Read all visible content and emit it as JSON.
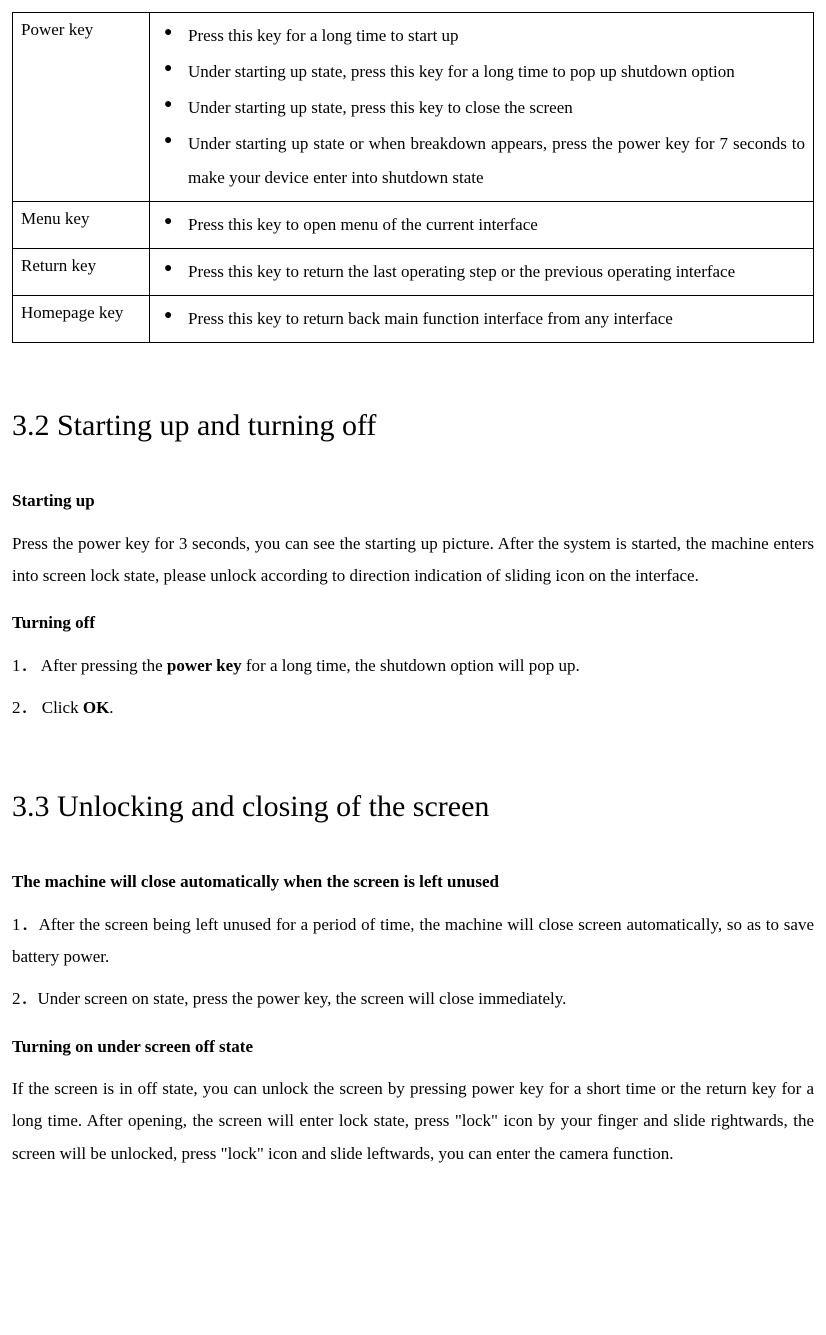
{
  "table": {
    "rows": [
      {
        "key": "Power key",
        "items": [
          "Press this key for a long time to start up",
          "Under starting up state, press this key for a long time to pop up shutdown option",
          "Under starting up state, press this key to close the screen",
          "Under starting up state or when breakdown appears, press the power key for 7 seconds to make your device enter into shutdown state"
        ]
      },
      {
        "key": "Menu key",
        "items": [
          "Press this key to open menu of the current interface"
        ]
      },
      {
        "key": "Return key",
        "items": [
          "Press this key to return the last operating step or the previous operating interface"
        ]
      },
      {
        "key": "Homepage key",
        "items": [
          "Press this key to return back main function interface from any interface"
        ]
      }
    ]
  },
  "section32": {
    "title": "3.2 Starting up and turning off",
    "sub1": "Starting up",
    "p1": "Press the power key for 3 seconds, you can see the starting up picture. After the system is started, the machine enters into screen lock state, please unlock according to direction indication of sliding icon on the interface.",
    "sub2": "Turning off",
    "step1_prefix": "1． After pressing the ",
    "step1_bold": "power key",
    "step1_suffix": " for a long time, the shutdown option will pop up.",
    "step2_prefix": "2． Click ",
    "step2_bold": "OK",
    "step2_suffix": "."
  },
  "section33": {
    "title": "3.3 Unlocking and closing of the screen",
    "sub1": "The machine will close automatically when the screen is left unused",
    "p1": "1．After the screen being left unused for a period of time, the machine will close screen automatically, so as to save battery power.",
    "p2": "2．Under screen on state, press the power key, the screen will close immediately.",
    "sub2": "Turning on under screen off state",
    "p3": "If the screen is in off state, you can unlock the screen by pressing power key for a short time or the return key for a long time. After opening, the screen will enter lock state, press \"lock\" icon by your finger and slide rightwards, the screen will be unlocked, press \"lock\" icon and slide leftwards, you can enter the camera function."
  }
}
